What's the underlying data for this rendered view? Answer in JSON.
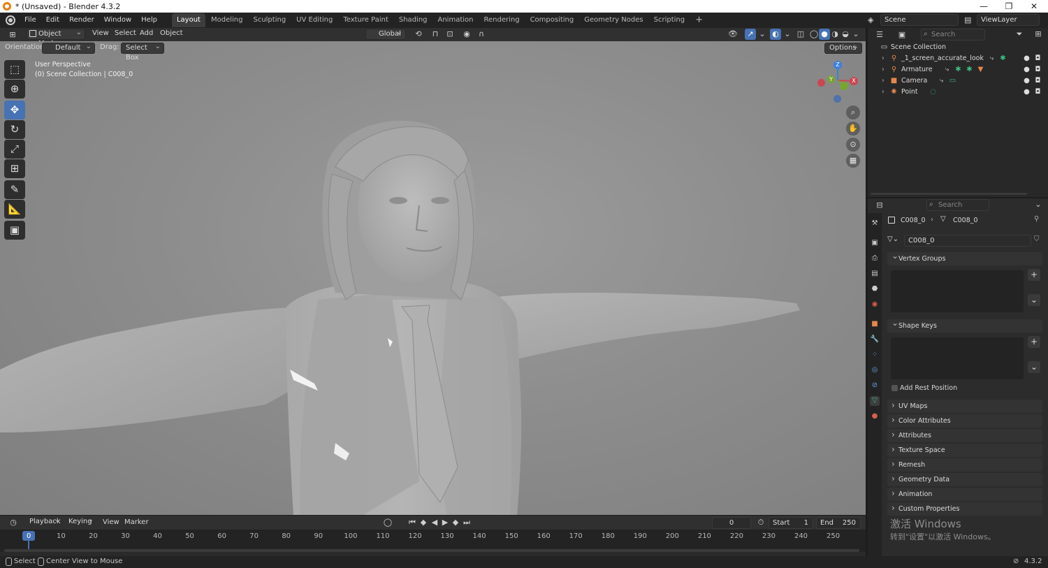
{
  "window": {
    "title": "* (Unsaved) - Blender 4.3.2",
    "controls": [
      "—",
      "❐",
      "✕"
    ]
  },
  "menu": [
    "File",
    "Edit",
    "Render",
    "Window",
    "Help"
  ],
  "workspaces": [
    "Layout",
    "Modeling",
    "Sculpting",
    "UV Editing",
    "Texture Paint",
    "Shading",
    "Animation",
    "Rendering",
    "Compositing",
    "Geometry Nodes",
    "Scripting"
  ],
  "workspace_add": "+",
  "scene": {
    "label": "Scene",
    "view_layer": "ViewLayer"
  },
  "viewport_header": {
    "mode": "Object Mode",
    "menus": [
      "View",
      "Select",
      "Add",
      "Object"
    ],
    "transform": "Global",
    "orientation_label": "Orientation:",
    "orientation_value": "Default",
    "drag_label": "Drag:",
    "drag_value": "Select Box",
    "options": "Options"
  },
  "viewport_overlay": {
    "line1": "User Perspective",
    "line2": "(0) Scene Collection | C008_0"
  },
  "gizmo": {
    "x": "X",
    "y": "Y",
    "z": "Z"
  },
  "gizmo_colors": {
    "x": "#c94750",
    "y": "#78a431",
    "z": "#3d7ee0"
  },
  "timeline": {
    "menus": [
      "Playback",
      "Keying",
      "View",
      "Marker"
    ],
    "current_frame": "0",
    "start_label": "Start",
    "start": "1",
    "end_label": "End",
    "end": "250",
    "ticks": [
      "0",
      "10",
      "20",
      "30",
      "40",
      "50",
      "60",
      "70",
      "80",
      "90",
      "100",
      "110",
      "120",
      "130",
      "140",
      "150",
      "160",
      "170",
      "180",
      "190",
      "200",
      "210",
      "220",
      "230",
      "240",
      "250"
    ]
  },
  "statusbar": {
    "select": "Select",
    "center": "Center View to Mouse",
    "version": "4.3.2"
  },
  "outliner": {
    "search_placeholder": "Search",
    "root": "Scene Collection",
    "items": [
      {
        "name": "_1_screen_accurate_look",
        "icon": "armature-icon"
      },
      {
        "name": "Armature",
        "icon": "armature-icon"
      },
      {
        "name": "Camera",
        "icon": "camera-icon"
      },
      {
        "name": "Point",
        "icon": "light-icon"
      }
    ]
  },
  "properties": {
    "search_placeholder": "Search",
    "breadcrumb_object": "C008_0",
    "breadcrumb_data": "C008_0",
    "mesh_name": "C008_0",
    "panels_open": [
      "Vertex Groups",
      "Shape Keys"
    ],
    "add_rest_position": "Add Rest Position",
    "panels_closed": [
      "UV Maps",
      "Color Attributes",
      "Attributes",
      "Texture Space",
      "Remesh",
      "Geometry Data",
      "Animation",
      "Custom Properties"
    ]
  },
  "activation_watermark": {
    "line1": "激活 Windows",
    "line2": "转到\"设置\"以激活 Windows。"
  },
  "accent": "#4772b3"
}
